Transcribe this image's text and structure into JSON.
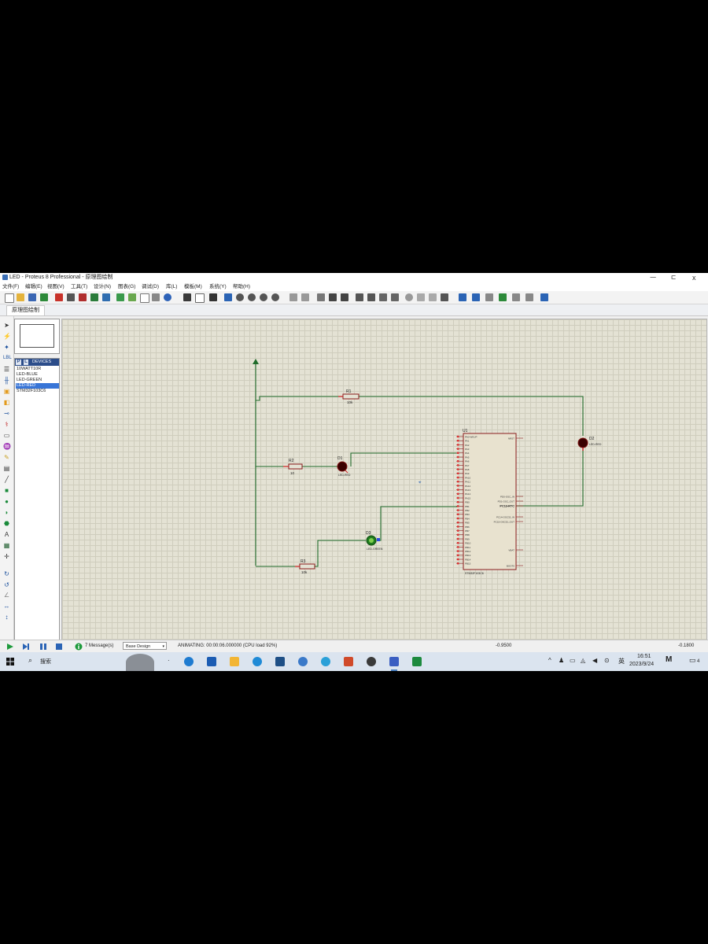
{
  "window": {
    "title": "LED - Proteus 8 Professional - 原理图绘制",
    "controls": {
      "minimize": "ㅡ",
      "restore": "ㄷ",
      "close": "x"
    }
  },
  "menu": [
    "文件(F)",
    "编辑(E)",
    "视图(V)",
    "工具(T)",
    "设计(N)",
    "图表(G)",
    "调试(D)",
    "库(L)",
    "模板(M)",
    "系统(Y)",
    "帮助(H)"
  ],
  "tab": {
    "label": "原理图绘制"
  },
  "device_panel": {
    "mode_p": "P",
    "mode_l": "L",
    "header": "DEVICES",
    "items": [
      "10WATT10R",
      "LED-BLUE",
      "LED-GREEN",
      "LED-RED",
      "STM32F103C6"
    ],
    "selected_index": 3
  },
  "schematic": {
    "components": [
      {
        "ref": "R1",
        "value": "10k",
        "type": "resistor"
      },
      {
        "ref": "R2",
        "value": "10",
        "type": "resistor"
      },
      {
        "ref": "R3",
        "value": "10k",
        "type": "resistor"
      },
      {
        "ref": "D1",
        "value": "LED-RED",
        "type": "led"
      },
      {
        "ref": "D2",
        "value": "LED-RED",
        "type": "led"
      },
      {
        "ref": "D3",
        "value": "LED-GREEN",
        "type": "led"
      },
      {
        "ref": "U1",
        "value": "STM32F103C6",
        "type": "ic"
      }
    ],
    "ic_labels": [
      "PA0-WKUP",
      "PA1",
      "PA2",
      "PA3",
      "PA4",
      "PA5",
      "PA6",
      "PA7",
      "PA8",
      "PA9",
      "PA10",
      "PA11",
      "PA12",
      "PA13",
      "PA14",
      "PA15",
      "PB0",
      "PB1",
      "PB2",
      "PB3",
      "PB4",
      "PB5",
      "PB6",
      "PB7",
      "PB8",
      "PB9",
      "PB10",
      "PB11",
      "PB12",
      "PB13",
      "PB14",
      "PB15"
    ],
    "ic_right_labels": [
      "NRST",
      "PD0-OSC_IN",
      "PD1-OSC_OUT",
      "PC13-RTC",
      "PC14-OSC32_IN",
      "PC15-OSC32_OUT",
      "VBAT",
      "BOOT0"
    ],
    "ic_right_highlight": "PC13-RTC"
  },
  "statusbar": {
    "messages": "7 Message(s)",
    "mode": "Base Design",
    "animating": "ANIMATING: 00:00:06.000000 (CPU load 92%)",
    "coord_x": "-0.9500",
    "coord_y": "-0.1800"
  },
  "taskbar": {
    "search": "搜索",
    "lang": "英",
    "time": "16:51",
    "date": "2023/9/24",
    "notif_count": "4"
  },
  "colors": {
    "wire": "#1f6b2a",
    "component": "#8a1c1c",
    "led_red": "#3a0000",
    "led_green": "#1f7a1f",
    "sheet": "#e4e2d4",
    "selection": "#3875d7"
  }
}
